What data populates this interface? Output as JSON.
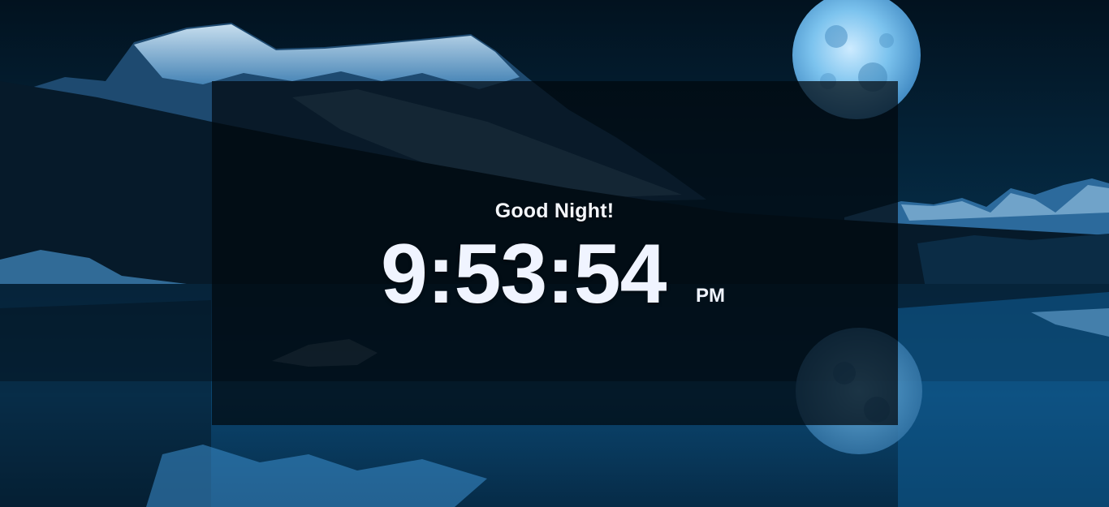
{
  "greeting": "Good Night!",
  "clock": {
    "time": "9:53:54",
    "period": "PM"
  },
  "background": {
    "description_icon": "night-lake-mountain-moon",
    "colors": {
      "sky": "#031a2c",
      "water": "#0a3a5e",
      "moon": "#7fc4ef",
      "panel": "#02080e"
    }
  }
}
